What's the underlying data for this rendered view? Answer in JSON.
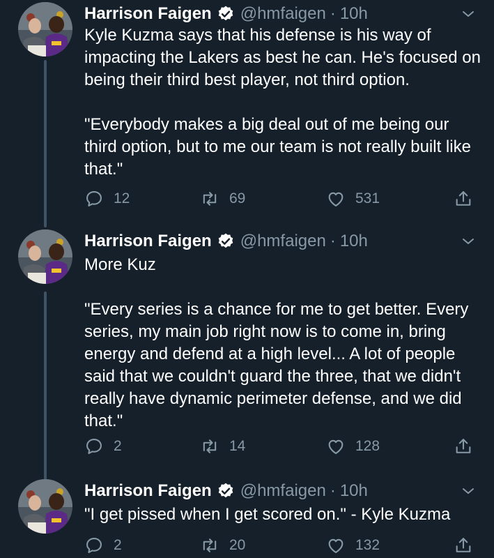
{
  "tweets": [
    {
      "author": "Harrison Faigen",
      "handle": "@hmfaigen",
      "separator": "·",
      "time": "10h",
      "text": "Kyle Kuzma says that his defense is his way of impacting the Lakers as best he can. He's focused on being their third best player, not third option.\n\n\"Everybody makes a big deal out of me being our third option, but to me our team is not really built like that.\"",
      "replies": "12",
      "retweets": "69",
      "likes": "531"
    },
    {
      "author": "Harrison Faigen",
      "handle": "@hmfaigen",
      "separator": "·",
      "time": "10h",
      "text": "More Kuz\n\n\"Every series is a chance for me to get better. Every series, my main job right now is to come in, bring energy and defend at a high level... A lot of people said that we couldn't guard the three, that we didn't really have dynamic perimeter defense, and we did that.\"",
      "replies": "2",
      "retweets": "14",
      "likes": "128"
    },
    {
      "author": "Harrison Faigen",
      "handle": "@hmfaigen",
      "separator": "·",
      "time": "10h",
      "text": "\"I get pissed when I get scored on.\" - Kyle Kuzma",
      "replies": "2",
      "retweets": "20",
      "likes": "132"
    }
  ],
  "colors": {
    "background": "#15202b",
    "text": "#ffffff",
    "secondary": "#8899a6",
    "verified": "#ffffff",
    "thread_line": "#3d5466"
  },
  "icons": {
    "reply": "speech-bubble-icon",
    "retweet": "retweet-arrows-icon",
    "like": "heart-icon",
    "share": "share-upload-icon",
    "menu": "chevron-down-icon",
    "verified": "verified-badge-icon"
  }
}
